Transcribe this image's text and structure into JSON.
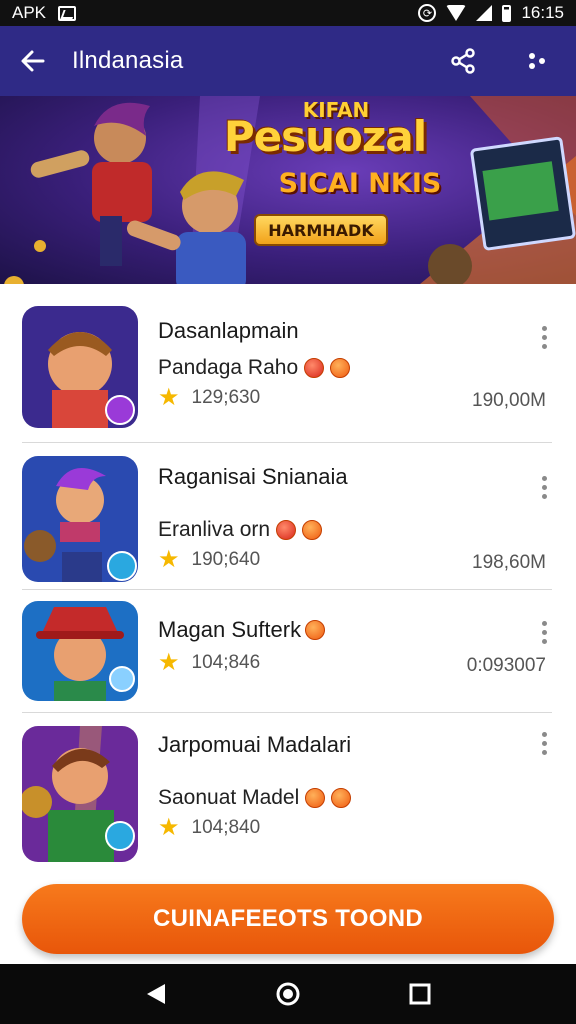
{
  "status_bar": {
    "left_text": "APK",
    "time": "16:15",
    "icons": [
      "gallery-icon",
      "sync-icon",
      "wifi-icon",
      "signal-icon",
      "battery-icon"
    ]
  },
  "app_bar": {
    "title": "Ilndanasia",
    "icons": [
      "back-arrow-icon",
      "share-icon",
      "more-dots-icon"
    ]
  },
  "banner": {
    "kicker": "KIFAN",
    "title": "Pesuozal",
    "subtitle": "SICAI NKIS",
    "pill": "HARMHADK"
  },
  "items": [
    {
      "name": "Dasanlapmain",
      "subtitle": "Pandaga Raho",
      "rating": "129;630",
      "size": "190,00M",
      "thumb_colors": [
        "#3b2a8e",
        "#d9463a"
      ]
    },
    {
      "name": "Raganisai Snianaia",
      "subtitle": "Eranliva orn",
      "rating": "190;640",
      "size": "198,60M",
      "thumb_colors": [
        "#2a4ab0",
        "#c03a6a"
      ]
    },
    {
      "name": "Magan Sufterk",
      "subtitle": "",
      "rating": "104;846",
      "size": "0:093007",
      "thumb_colors": [
        "#1d6fc4",
        "#c42a2a"
      ]
    },
    {
      "name": "Jarpomuai Madalari",
      "subtitle": "Saonuat Madel",
      "rating": "104;840",
      "size": "",
      "thumb_colors": [
        "#6a2a9a",
        "#2a8a3a"
      ]
    }
  ],
  "cta": {
    "label": "CUINAFEEOTS TOOND"
  },
  "nav_bar": {
    "icons": [
      "back-triangle-icon",
      "home-circle-icon",
      "recents-square-icon"
    ]
  }
}
